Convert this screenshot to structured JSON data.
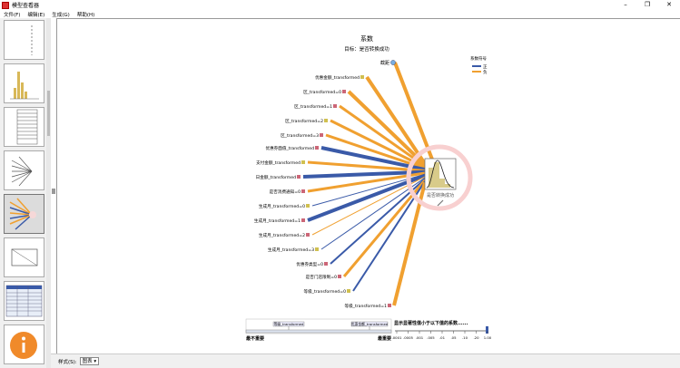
{
  "window": {
    "title": "模型查看器",
    "controls": [
      "–",
      "❐",
      "✕"
    ]
  },
  "menu": [
    "文件(F)",
    "编辑(E)",
    "生成(G)",
    "帮助(H)"
  ],
  "chart": {
    "title": "系数",
    "subtitle": "目标：是否转换成功",
    "legend_title": "系数符号",
    "legend_items": [
      {
        "label": "正",
        "color": "#3a5aa8"
      },
      {
        "label": "负",
        "color": "#f0a030"
      }
    ],
    "intercept_label": "截距",
    "target_label": "是否转换成功",
    "predictors": [
      "优惠金额_transformed",
      "区_transformed=0",
      "区_transformed=1",
      "区_transformed=2",
      "区_transformed=3",
      "优惠券面值_transformed",
      "支付金额_transformed",
      "日金额_transformed",
      "是否消费通知=0",
      "生成月_transformed=0",
      "生成月_transformed=1",
      "生成月_transformed=2",
      "生成月_transformed=3",
      "优惠券类型=0",
      "是否门店限制=0",
      "等级_transformed=0",
      "等级_transformed=1"
    ],
    "slider": {
      "left_caption": "最不重要",
      "right_caption": "最重要",
      "left_tag": "等级_transformed",
      "right_tag": "优惠金额_transformed"
    },
    "significance": {
      "caption": "显示显著性值小于以下值的系数......",
      "ticks": [
        ".0001",
        ".0005",
        ".001",
        ".005",
        ".01",
        ".05",
        ".10",
        ".20",
        "1.00"
      ]
    }
  },
  "chart_data": {
    "type": "diagram",
    "title": "系数",
    "subtitle": "目标：是否转换成功",
    "series": [
      {
        "name": "截距",
        "sign": "正"
      },
      {
        "name": "优惠金额_transformed",
        "sign": "负"
      },
      {
        "name": "区_transformed=0",
        "sign": "负"
      },
      {
        "name": "区_transformed=1",
        "sign": "负"
      },
      {
        "name": "区_transformed=2",
        "sign": "负"
      },
      {
        "name": "区_transformed=3",
        "sign": "负"
      },
      {
        "name": "优惠券面值_transformed",
        "sign": "正"
      },
      {
        "name": "支付金额_transformed",
        "sign": "负"
      },
      {
        "name": "日金额_transformed",
        "sign": "正"
      },
      {
        "name": "是否消费通知=0",
        "sign": "负"
      },
      {
        "name": "生成月_transformed=0",
        "sign": "正"
      },
      {
        "name": "生成月_transformed=1",
        "sign": "正"
      },
      {
        "name": "生成月_transformed=2",
        "sign": "负"
      },
      {
        "name": "生成月_transformed=3",
        "sign": "正"
      },
      {
        "name": "优惠券类型=0",
        "sign": "正"
      },
      {
        "name": "是否门店限制=0",
        "sign": "负"
      },
      {
        "name": "等级_transformed=0",
        "sign": "正"
      },
      {
        "name": "等级_transformed=1",
        "sign": "负"
      }
    ]
  },
  "status": {
    "style_label": "样式(S):",
    "style_value": "图表"
  }
}
